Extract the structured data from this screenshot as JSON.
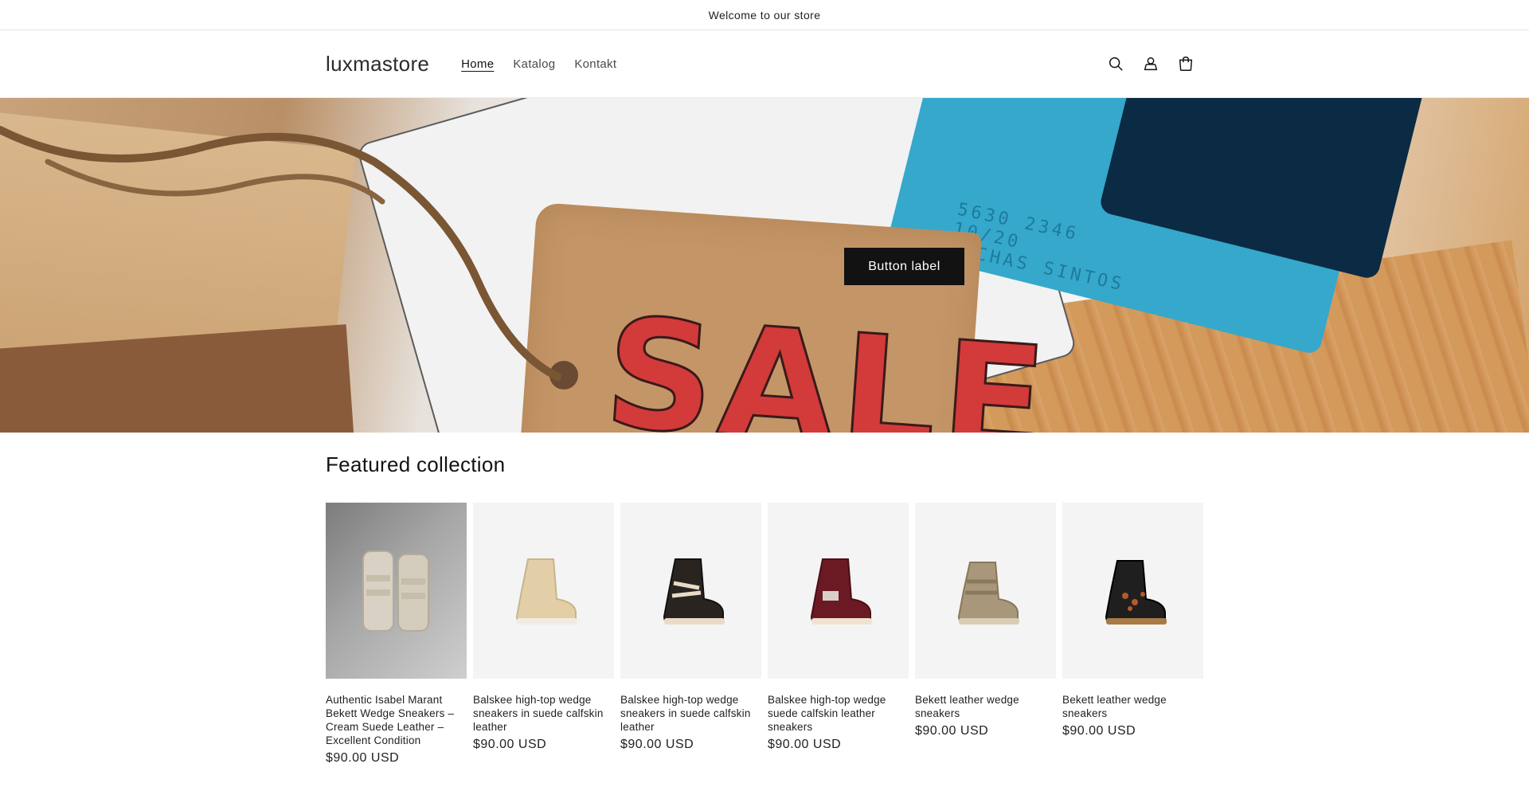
{
  "announcement": {
    "text": "Welcome to our store"
  },
  "header": {
    "logo": "luxmastore",
    "nav": [
      {
        "label": "Home",
        "active": true
      },
      {
        "label": "Katalog",
        "active": false
      },
      {
        "label": "Kontakt",
        "active": false
      }
    ],
    "icons": [
      "search-icon",
      "account-icon",
      "cart-icon"
    ]
  },
  "hero": {
    "image_text": "SALE",
    "card_text_line1": "5630 2346",
    "card_text_line2": "10/20",
    "card_text_line3": "LUCHAS SINTOS",
    "button_label": "Button label"
  },
  "collection": {
    "title": "Featured collection",
    "products": [
      {
        "title": "Authentic Isabel Marant Bekett Wedge Sneakers – Cream Suede Leather – Excellent Condition",
        "price": "$90.00 USD",
        "color": "#d9d2c4",
        "photo": true
      },
      {
        "title": "Balskee high-top wedge sneakers in suede calfskin leather",
        "price": "$90.00 USD",
        "color": "#e2cfa8",
        "photo": false
      },
      {
        "title": "Balskee high-top wedge sneakers in suede calfskin leather",
        "price": "$90.00 USD",
        "color": "#2a2420",
        "photo": false
      },
      {
        "title": "Balskee high-top wedge suede calfskin leather sneakers",
        "price": "$90.00 USD",
        "color": "#6b1a24",
        "photo": false
      },
      {
        "title": "Bekett leather wedge sneakers",
        "price": "$90.00 USD",
        "color": "#a8977a",
        "photo": false
      },
      {
        "title": "Bekett leather wedge sneakers",
        "price": "$90.00 USD",
        "color": "#1f1f1f",
        "photo": false
      }
    ]
  }
}
